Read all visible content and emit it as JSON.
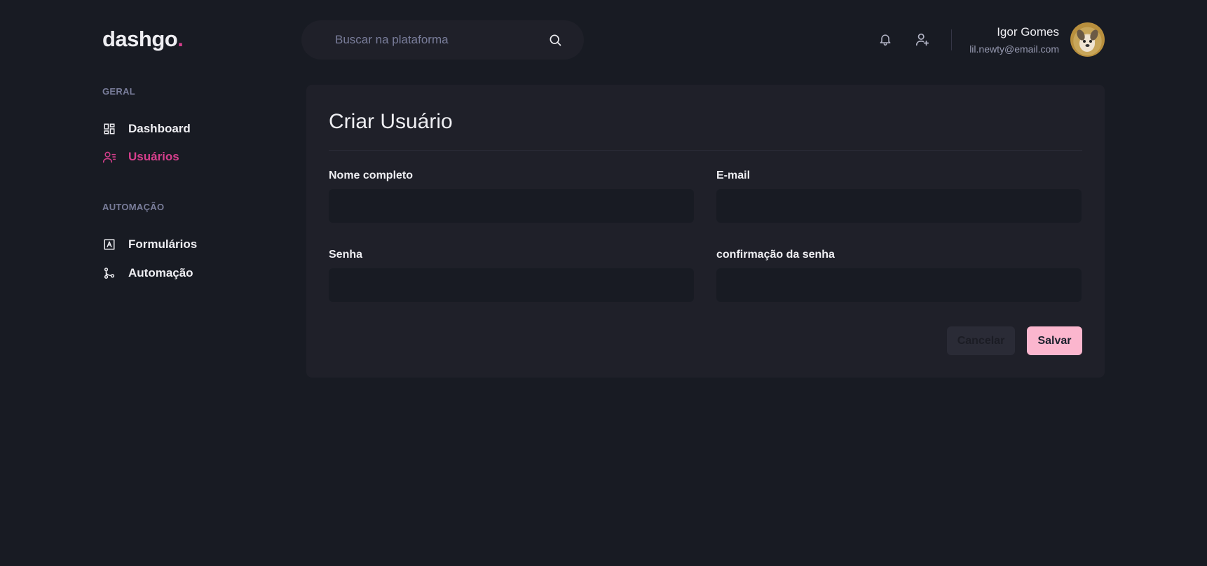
{
  "header": {
    "logo_text": "dashgo",
    "logo_dot": ".",
    "search_placeholder": "Buscar na plataforma",
    "search_icon": "search-icon",
    "notification_icon": "bell-icon",
    "add_user_icon": "user-plus-icon",
    "profile": {
      "name": "Igor Gomes",
      "email": "lil.newty@email.com"
    }
  },
  "sidebar": {
    "sections": [
      {
        "title": "GERAL",
        "items": [
          {
            "label": "Dashboard",
            "icon": "dashboard-grid-icon",
            "active": false
          },
          {
            "label": "Usuários",
            "icon": "users-list-icon",
            "active": true
          }
        ]
      },
      {
        "title": "AUTOMAÇÃO",
        "items": [
          {
            "label": "Formulários",
            "icon": "form-icon",
            "active": false
          },
          {
            "label": "Automação",
            "icon": "git-branch-icon",
            "active": false
          }
        ]
      }
    ]
  },
  "form": {
    "title": "Criar Usuário",
    "fields": [
      {
        "label": "Nome completo",
        "value": ""
      },
      {
        "label": "E-mail",
        "value": ""
      },
      {
        "label": "Senha",
        "value": ""
      },
      {
        "label": "confirmação da senha",
        "value": ""
      }
    ],
    "cancel_label": "Cancelar",
    "save_label": "Salvar"
  },
  "colors": {
    "background": "#181b23",
    "card": "#1f2029",
    "accent": "#d53f8c",
    "save_button": "#fbb6ce",
    "muted_text": "#797d9a"
  }
}
